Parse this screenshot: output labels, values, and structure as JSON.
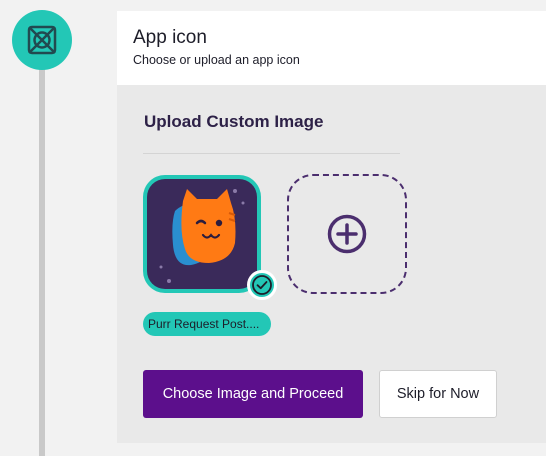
{
  "step": {
    "icon": "layout-grid-icon"
  },
  "card": {
    "title": "App icon",
    "subtitle": "Choose or upload an app icon",
    "section_title": "Upload Custom Image"
  },
  "selected_image": {
    "name": "Purr Request Post....",
    "icon": "cat-mascot-image",
    "selected_icon": "check-circle-icon"
  },
  "upload": {
    "icon": "plus-circle-icon"
  },
  "buttons": {
    "primary": "Choose Image and Proceed",
    "secondary": "Skip for Now"
  },
  "colors": {
    "accent": "#23c7b6",
    "primary_button": "#5c0f8c",
    "heading": "#2d2147",
    "card_background": "#e9e9e9"
  }
}
